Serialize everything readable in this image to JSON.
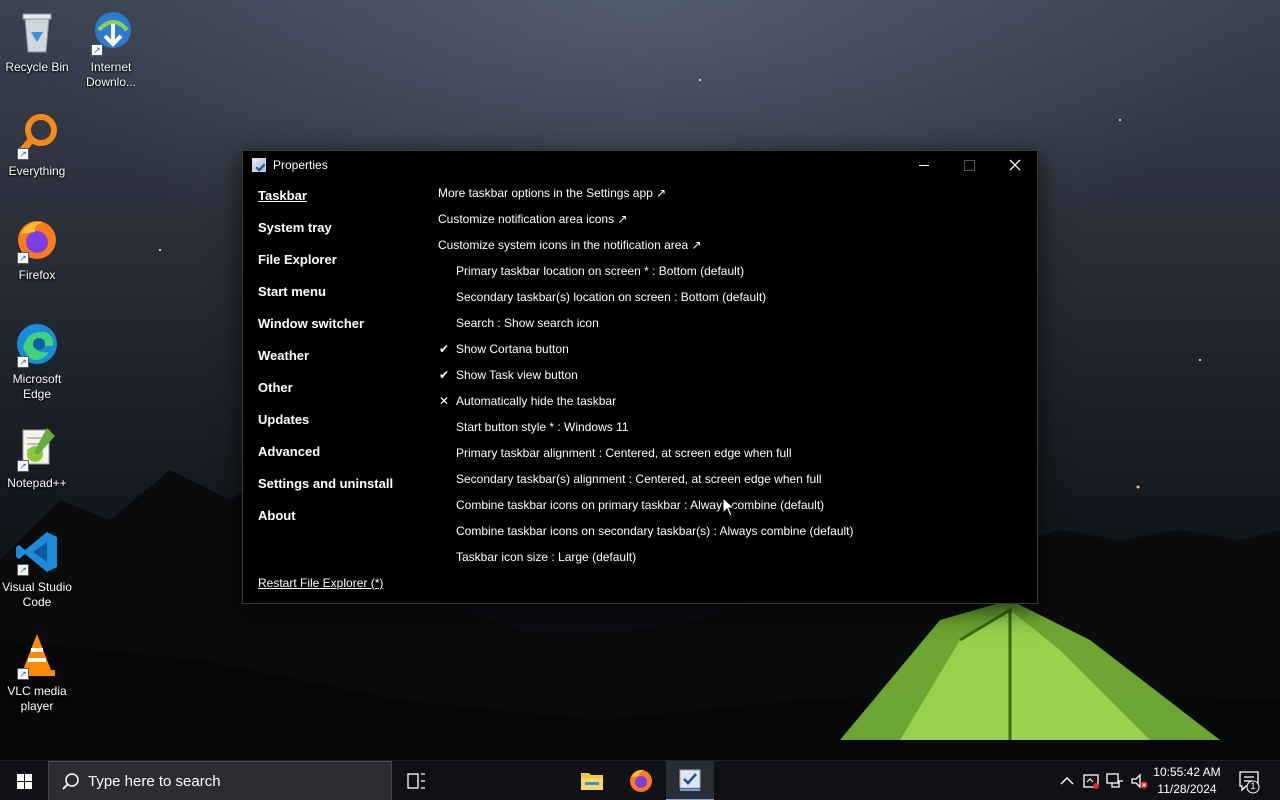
{
  "desktop": {
    "icons": [
      {
        "label": "Recycle Bin",
        "icon": "recycle-bin-icon"
      },
      {
        "label": "Internet Downlo...",
        "icon": "internet-download-manager-icon"
      },
      {
        "label": "Everything",
        "icon": "everything-search-icon"
      },
      {
        "label": "Firefox",
        "icon": "firefox-icon"
      },
      {
        "label": "Microsoft Edge",
        "icon": "edge-icon"
      },
      {
        "label": "Notepad++",
        "icon": "notepadpp-icon"
      },
      {
        "label": "Visual Studio Code",
        "icon": "vscode-icon"
      },
      {
        "label": "VLC media player",
        "icon": "vlc-icon"
      }
    ]
  },
  "window": {
    "title": "Properties",
    "nav": [
      {
        "label": "Taskbar",
        "active": true
      },
      {
        "label": "System tray"
      },
      {
        "label": "File Explorer"
      },
      {
        "label": "Start menu"
      },
      {
        "label": "Window switcher"
      },
      {
        "label": "Weather"
      },
      {
        "label": "Other"
      },
      {
        "label": "Updates"
      },
      {
        "label": "Advanced"
      },
      {
        "label": "Settings and uninstall"
      },
      {
        "label": "About"
      }
    ],
    "restart_link": "Restart File Explorer (*)",
    "links": [
      "More taskbar options in the Settings app ↗",
      "Customize notification area icons ↗",
      "Customize system icons in the notification area ↗"
    ],
    "settings": [
      {
        "label": "Primary taskbar location on screen * : Bottom (default)",
        "mark": ""
      },
      {
        "label": "Secondary taskbar(s) location on screen : Bottom (default)",
        "mark": ""
      },
      {
        "label": "Search : Show search icon",
        "mark": ""
      },
      {
        "label": "Show Cortana button",
        "mark": "✔"
      },
      {
        "label": "Show Task view button",
        "mark": "✔"
      },
      {
        "label": "Automatically hide the taskbar",
        "mark": "✕"
      },
      {
        "label": "Start button style * : Windows 11",
        "mark": ""
      },
      {
        "label": "Primary taskbar alignment : Centered, at screen edge when full",
        "mark": ""
      },
      {
        "label": "Secondary taskbar(s) alignment : Centered, at screen edge when full",
        "mark": ""
      },
      {
        "label": "Combine taskbar icons on primary taskbar : Always combine (default)",
        "mark": ""
      },
      {
        "label": "Combine taskbar icons on secondary taskbar(s) : Always combine (default)",
        "mark": ""
      },
      {
        "label": "Taskbar icon size : Large (default)",
        "mark": ""
      }
    ]
  },
  "taskbar": {
    "search_placeholder": "Type here to search",
    "apps": [
      "task-view-icon",
      "file-explorer-icon",
      "firefox-icon",
      "properties-app-icon"
    ],
    "clock_time": "10:55:42 AM",
    "clock_date": "11/28/2024",
    "notification_count": "1"
  },
  "colors": {
    "accent": "#7aa7e0",
    "window_bg": "#000000",
    "tent_glow": "#9adc3c"
  }
}
